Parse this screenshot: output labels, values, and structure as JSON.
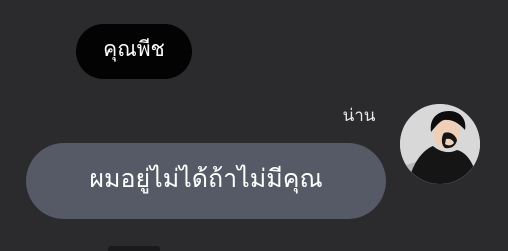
{
  "contact": {
    "name": "คุณพีช"
  },
  "message": {
    "status": "น่าน",
    "text": "ผมอยู่ไม่ได้ถ้าไม่มีคุณ"
  },
  "colors": {
    "background": "#2b2b2e",
    "name_pill": "#030303",
    "bubble": "#555a66",
    "text": "#ffffff"
  }
}
